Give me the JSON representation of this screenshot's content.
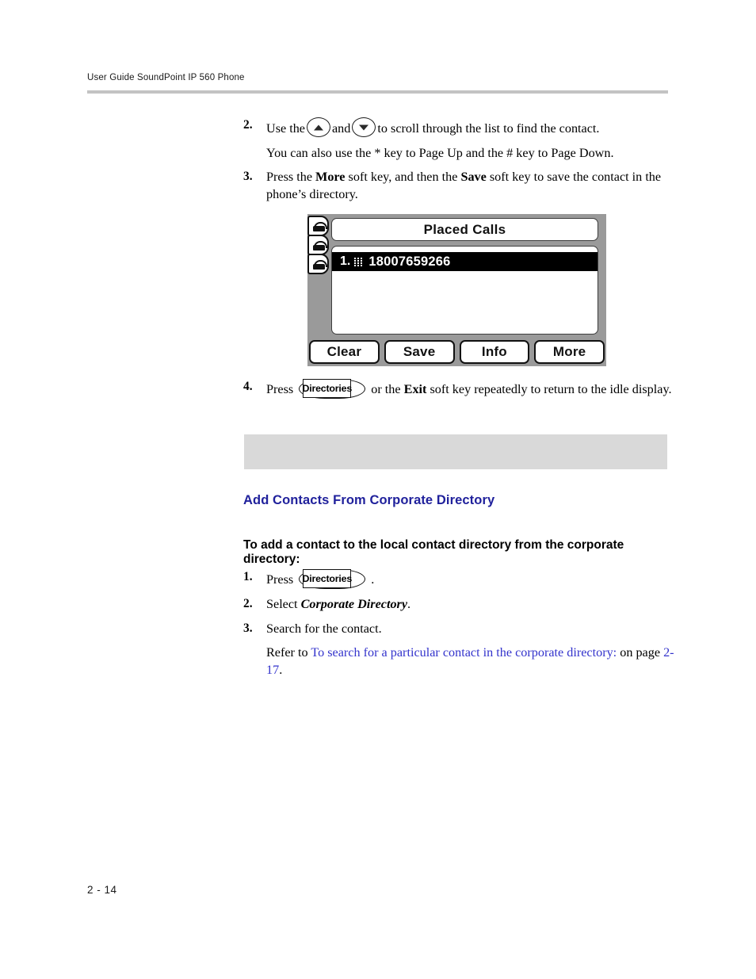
{
  "header": {
    "running_head": "User Guide SoundPoint IP 560 Phone"
  },
  "footer": {
    "page_number": "2 - 14"
  },
  "colors": {
    "heading_blue": "#20219c",
    "xref_blue": "#3333cc",
    "note_gray": "#d9d9d9",
    "rule_gray": "#c3c3c3",
    "phone_body_gray": "#9a9a9a"
  },
  "steps_top": [
    {
      "number": "2.",
      "text_before": "Use the",
      "key_up": "scroll-up-key",
      "text_mid": "and",
      "key_down": "scroll-down-key",
      "text_after": "to scroll through the list to find the contact.",
      "sub_paragraph": "You can also use the * key to Page Up and the # key to Page Down."
    },
    {
      "number": "3.",
      "part1": "Press the ",
      "bold1": "More",
      "part2": " soft key, and then the ",
      "bold2": "Save",
      "part3": " soft key to save the contact in the phone’s directory."
    },
    {
      "number": "4.",
      "part1": "Press ",
      "key_label": "Directories",
      "part2": " or the ",
      "bold1": "Exit",
      "part3": " soft key repeatedly to return to the idle display."
    }
  ],
  "phone_figure": {
    "line_keys": [
      "line-key-1",
      "line-key-2",
      "line-key-3"
    ],
    "lcd_title": "Placed Calls",
    "call_entries": [
      {
        "index": "1.",
        "icon": "keypad-icon",
        "number": "18007659266",
        "selected": true
      }
    ],
    "soft_keys": [
      "Clear",
      "Save",
      "Info",
      "More"
    ]
  },
  "note": {
    "text": ""
  },
  "section": {
    "heading": "Add Contacts From Corporate Directory",
    "intro": "To add a contact to the local contact directory from the corporate directory:"
  },
  "steps_bottom": [
    {
      "number": "1.",
      "part1": "Press ",
      "key_label": "Directories",
      "part2": " ."
    },
    {
      "number": "2.",
      "part1": "Select ",
      "italic1": "Corporate Directory",
      "part2": "."
    },
    {
      "number": "3.",
      "part1": "Search for the contact."
    }
  ],
  "reference": {
    "lead": "Refer to ",
    "link_text": "To search for a particular contact in the corporate directory:",
    "mid": " on page ",
    "page_link": "2-17",
    "tail": "."
  }
}
